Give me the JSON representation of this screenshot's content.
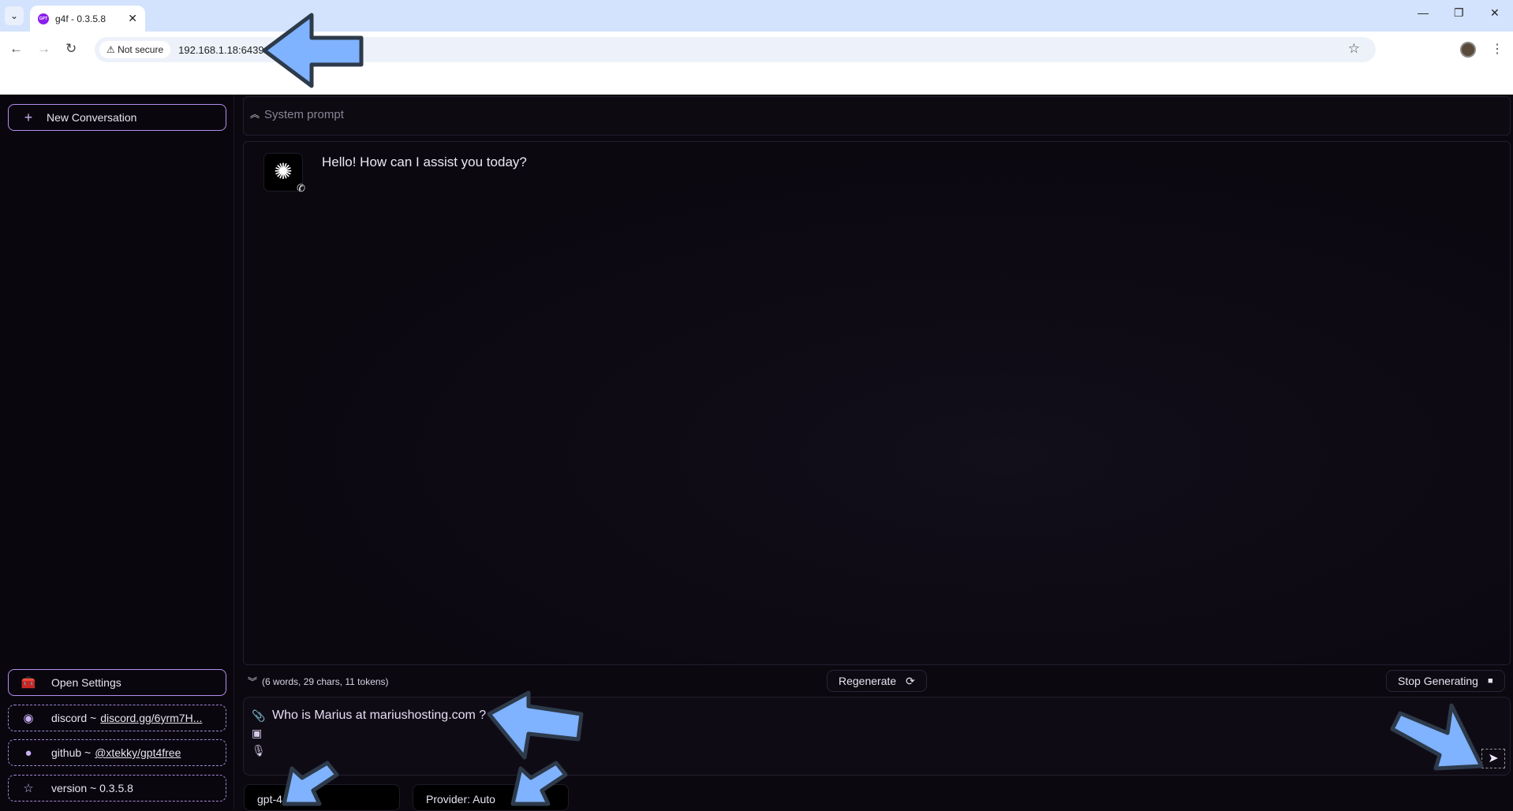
{
  "browser": {
    "tab_title": "g4f - 0.3.5.8",
    "favicon_text": "GPT",
    "security_label": "Not secure",
    "url": "192.168.1.18:6439"
  },
  "sidebar": {
    "new_conversation": "New Conversation",
    "open_settings": "Open Settings",
    "discord_label": "discord ~",
    "discord_link": "discord.gg/6yrm7H...",
    "github_label": "github ~",
    "github_link": "@xtekky/gpt4free",
    "version": "version ~ 0.3.5.8"
  },
  "main": {
    "system_prompt_placeholder": "System prompt",
    "messages": [
      {
        "role": "assistant",
        "text": "Hello! How can I assist you today?"
      }
    ],
    "stats": "(6 words, 29 chars, 11 tokens)",
    "regenerate": "Regenerate",
    "stop_generating": "Stop Generating",
    "input_value": "Who is Marius at mariushosting.com ?",
    "model": "gpt-4",
    "provider": "Provider: Auto"
  },
  "colors": {
    "accent": "#b48df0",
    "annotation_arrow": "#7fb2ff",
    "background": "#0b0810"
  }
}
